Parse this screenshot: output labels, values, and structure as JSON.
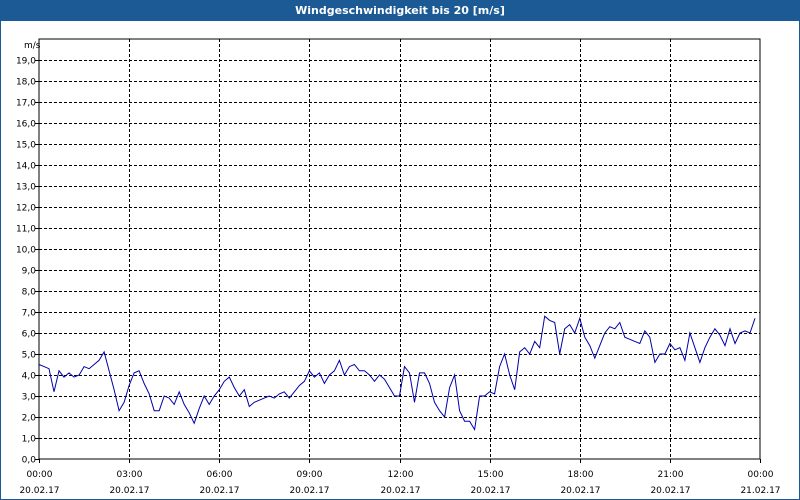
{
  "chart_data": {
    "type": "line",
    "title": "Windgeschwindigkeit bis 20 [m/s]",
    "unit_label": "m/s",
    "ylim": [
      0,
      20
    ],
    "y_ticks": [
      "0,0",
      "1,0",
      "2,0",
      "3,0",
      "4,0",
      "5,0",
      "6,0",
      "7,0",
      "8,0",
      "9,0",
      "10,0",
      "11,0",
      "12,0",
      "13,0",
      "14,0",
      "15,0",
      "16,0",
      "17,0",
      "18,0",
      "19,0"
    ],
    "x_ticks": [
      {
        "time": "00:00",
        "date": "20.02.17"
      },
      {
        "time": "03:00",
        "date": "20.02.17"
      },
      {
        "time": "06:00",
        "date": "20.02.17"
      },
      {
        "time": "09:00",
        "date": "20.02.17"
      },
      {
        "time": "12:00",
        "date": "20.02.17"
      },
      {
        "time": "15:00",
        "date": "20.02.17"
      },
      {
        "time": "18:00",
        "date": "20.02.17"
      },
      {
        "time": "21:00",
        "date": "20.02.17"
      },
      {
        "time": "00:00",
        "date": "21.02.17"
      }
    ],
    "grid": true,
    "series": [
      {
        "color": "#0000aa",
        "x": [
          "00:00",
          "00:10",
          "00:20",
          "00:30",
          "00:40",
          "00:50",
          "01:00",
          "01:10",
          "01:20",
          "01:30",
          "01:40",
          "01:50",
          "02:00",
          "02:10",
          "02:20",
          "02:30",
          "02:40",
          "02:50",
          "03:00",
          "03:10",
          "03:20",
          "03:30",
          "03:40",
          "03:50",
          "04:00",
          "04:10",
          "04:20",
          "04:30",
          "04:40",
          "04:50",
          "05:00",
          "05:10",
          "05:20",
          "05:30",
          "05:40",
          "05:50",
          "06:00",
          "06:10",
          "06:20",
          "06:30",
          "06:40",
          "06:50",
          "07:00",
          "07:10",
          "07:20",
          "07:30",
          "07:40",
          "07:50",
          "08:00",
          "08:10",
          "08:20",
          "08:30",
          "08:40",
          "08:50",
          "09:00",
          "09:10",
          "09:20",
          "09:30",
          "09:40",
          "09:50",
          "10:00",
          "10:10",
          "10:20",
          "10:30",
          "10:40",
          "10:50",
          "11:00",
          "11:10",
          "11:20",
          "11:30",
          "11:40",
          "11:50",
          "12:00",
          "12:10",
          "12:20",
          "12:30",
          "12:40",
          "12:50",
          "13:00",
          "13:10",
          "13:20",
          "13:30",
          "13:40",
          "13:50",
          "14:00",
          "14:10",
          "14:20",
          "14:30",
          "14:40",
          "14:50",
          "15:00",
          "15:10",
          "15:20",
          "15:30",
          "15:40",
          "15:50",
          "16:00",
          "16:10",
          "16:20",
          "16:30",
          "16:40",
          "16:50",
          "17:00",
          "17:10",
          "17:20",
          "17:30",
          "17:40",
          "17:50",
          "18:00",
          "18:10",
          "18:20",
          "18:30",
          "18:40",
          "18:50",
          "19:00",
          "19:10",
          "19:20",
          "19:30",
          "19:40",
          "19:50",
          "20:00",
          "20:10",
          "20:20",
          "20:30",
          "20:40",
          "20:50",
          "21:00",
          "21:10",
          "21:20",
          "21:30",
          "21:40",
          "21:50",
          "22:00",
          "22:10",
          "22:20",
          "22:30",
          "22:40",
          "22:50",
          "23:00",
          "23:10",
          "23:20",
          "23:30",
          "23:40",
          "23:50"
        ],
        "values": [
          4.5,
          4.4,
          4.3,
          3.2,
          4.2,
          3.9,
          4.1,
          3.9,
          4.0,
          4.4,
          4.3,
          4.5,
          4.7,
          5.1,
          4.2,
          3.3,
          2.3,
          2.7,
          3.5,
          4.1,
          4.2,
          3.6,
          3.1,
          2.3,
          2.3,
          3.0,
          2.9,
          2.6,
          3.2,
          2.6,
          2.2,
          1.7,
          2.4,
          3.0,
          2.6,
          3.0,
          3.3,
          3.7,
          3.9,
          3.4,
          3.0,
          3.3,
          2.5,
          2.7,
          2.8,
          2.9,
          3.0,
          2.9,
          3.1,
          3.2,
          2.9,
          3.2,
          3.5,
          3.7,
          4.2,
          3.9,
          4.1,
          3.6,
          4.0,
          4.2,
          4.7,
          4.0,
          4.4,
          4.5,
          4.2,
          4.2,
          4.0,
          3.7,
          4.0,
          3.8,
          3.4,
          3.0,
          3.0,
          4.4,
          4.1,
          2.7,
          4.1,
          4.1,
          3.6,
          2.7,
          2.3,
          2.0,
          3.4,
          4.0,
          2.3,
          1.8,
          1.8,
          1.4,
          3.0,
          3.0,
          3.2,
          3.1,
          4.4,
          5.0,
          4.0,
          3.3,
          5.1,
          5.3,
          5.0,
          5.6,
          5.3,
          6.8,
          6.6,
          6.5,
          5.0,
          6.2,
          6.4,
          6.0,
          6.7,
          5.8,
          5.4,
          4.8,
          5.4,
          6.0,
          6.3,
          6.2,
          6.5,
          5.8,
          5.7,
          5.6,
          5.5,
          6.1,
          5.8,
          4.6,
          5.0,
          5.0,
          5.5,
          5.2,
          5.3,
          4.7,
          6.0,
          5.3,
          4.6,
          5.3,
          5.8,
          6.2,
          5.9,
          5.4,
          6.2,
          5.5,
          6.0,
          6.1,
          6.0,
          6.7
        ]
      }
    ]
  }
}
